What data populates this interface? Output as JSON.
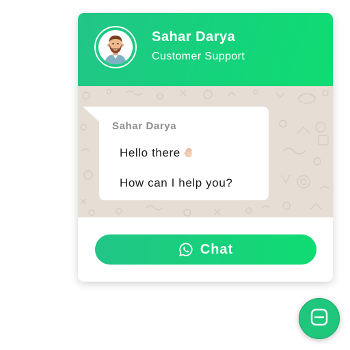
{
  "agent": {
    "name": "Sahar Darya",
    "role": "Customer Support",
    "avatar_icon": "bearded-man-avatar"
  },
  "conversation": {
    "sender": "Sahar Darya",
    "messages": [
      {
        "text": "Hello there",
        "emoji_icon": "waving-hand-icon"
      },
      {
        "text": "How can I help you?"
      }
    ]
  },
  "chat_button": {
    "label": "Chat",
    "icon": "whatsapp-icon"
  },
  "toggle_button": {
    "icon": "minimize-icon"
  },
  "colors": {
    "brand_green": "#1ec77c",
    "gradient_start": "#22c587",
    "gradient_end": "#0fdc72",
    "chat_background": "#e6ddd4"
  }
}
